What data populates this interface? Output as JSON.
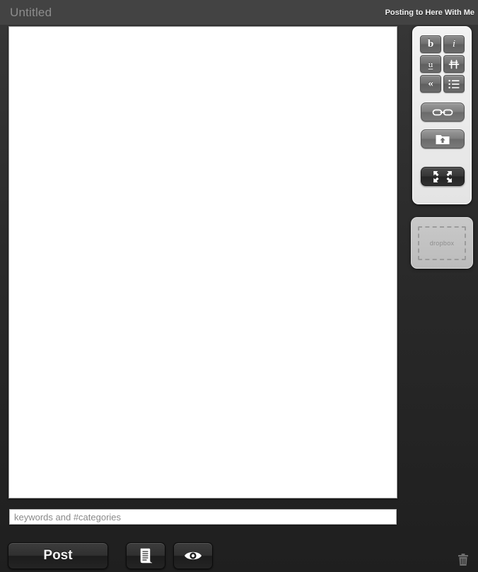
{
  "window": {
    "title": "Untitled",
    "posting_to": "Posting to Here With Me"
  },
  "editor": {
    "content": "",
    "placeholder": ""
  },
  "keywords": {
    "value": "",
    "placeholder": "keywords and #categories"
  },
  "format_toolbar": {
    "buttons": [
      {
        "name": "bold",
        "label": "b",
        "icon": "bold-icon"
      },
      {
        "name": "italic",
        "label": "i",
        "icon": "italic-icon"
      },
      {
        "name": "underline",
        "label": "u",
        "icon": "underline-icon"
      },
      {
        "name": "strikethrough",
        "label": "H",
        "icon": "strikethrough-icon"
      },
      {
        "name": "blockquote",
        "label": "«",
        "icon": "blockquote-icon"
      },
      {
        "name": "list",
        "label": "",
        "icon": "bulleted-list-icon"
      }
    ],
    "link_label": "",
    "upload_label": "",
    "fullscreen_label": ""
  },
  "dropbox": {
    "label": "dropbox"
  },
  "actions": {
    "post_label": "Post",
    "notes_label": "",
    "preview_label": "",
    "trash_label": ""
  },
  "colors": {
    "titlebar": "#434343",
    "background": "#2a2a2a",
    "editor_background": "#ffffff",
    "panel_light": "#f3f3f3",
    "accent_text": "#f2f2f2",
    "muted_text": "#8d8d8d"
  }
}
